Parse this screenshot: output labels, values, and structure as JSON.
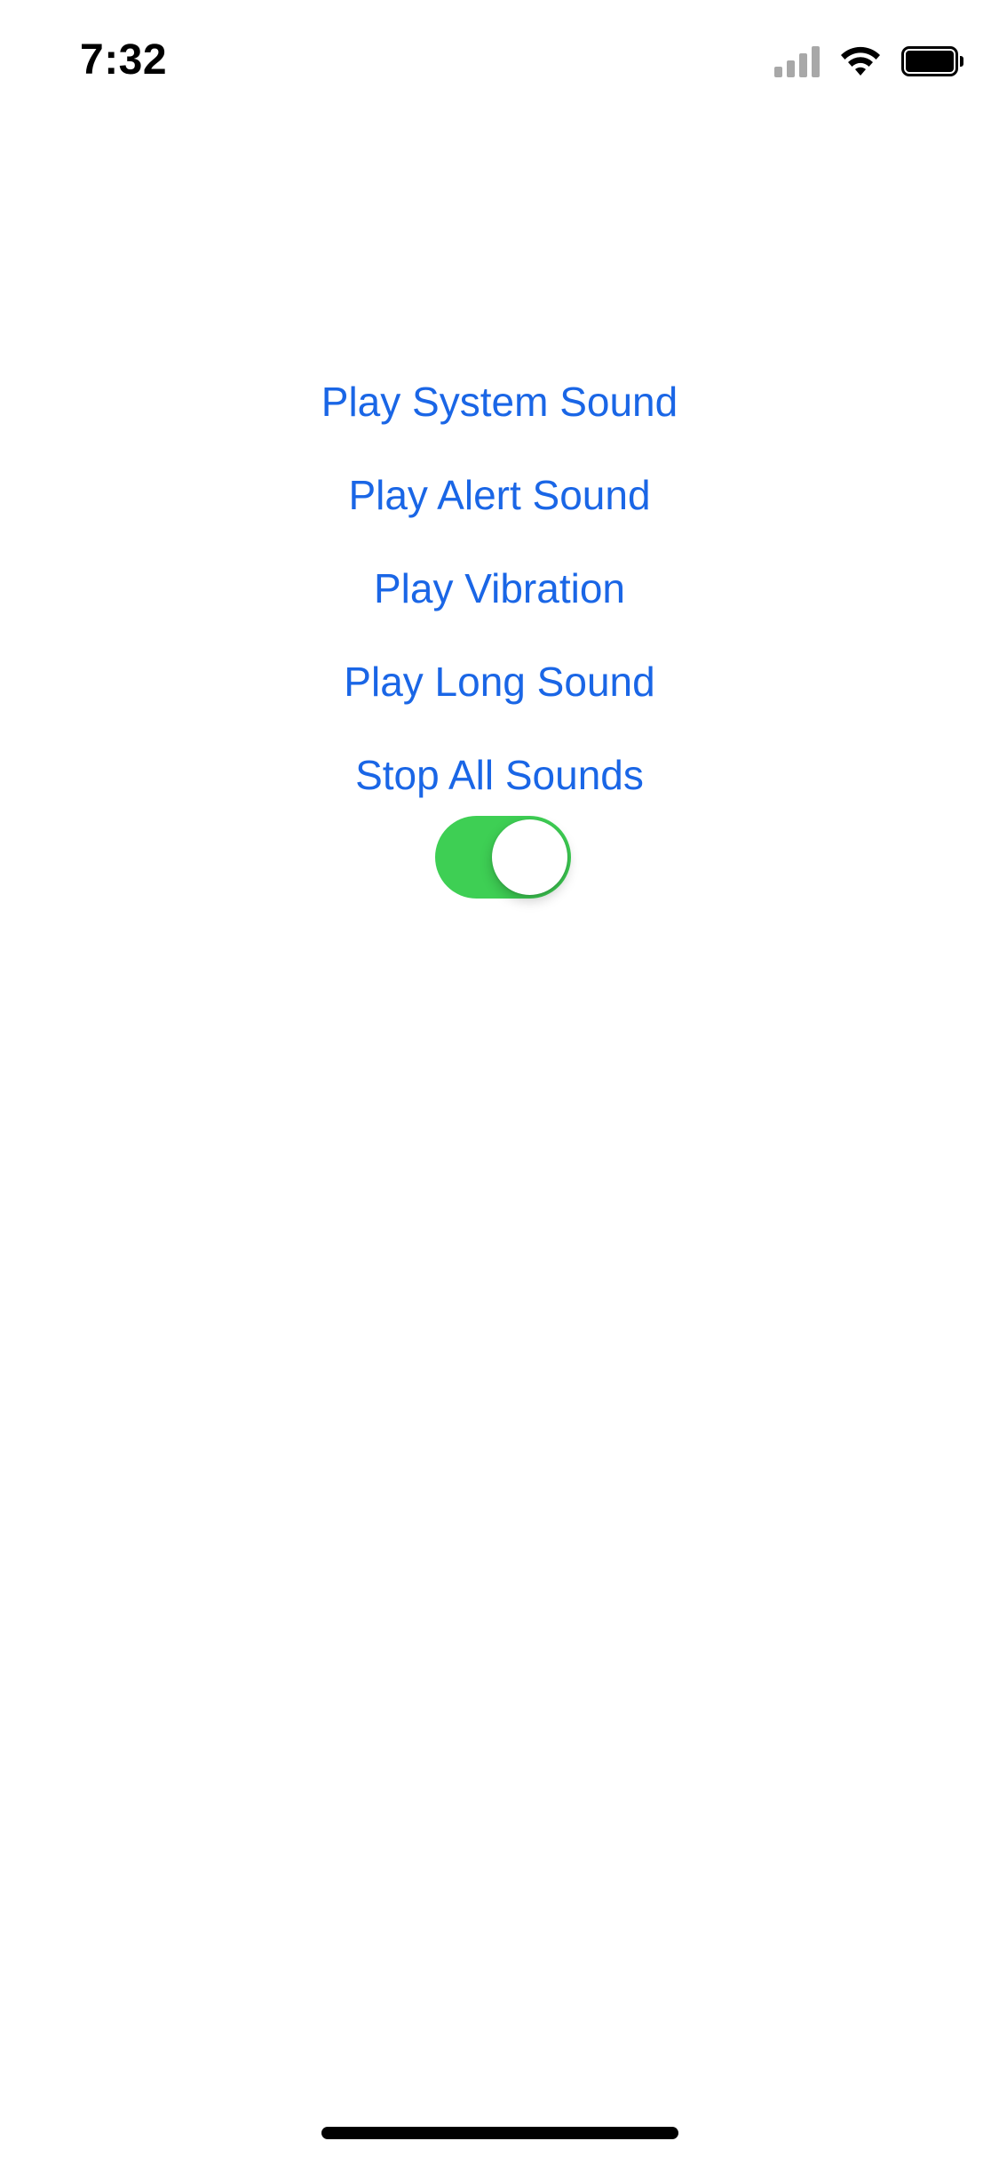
{
  "status_bar": {
    "time": "7:32",
    "icons": [
      "cellular-signal-icon",
      "wifi-icon",
      "battery-icon"
    ]
  },
  "actions": {
    "play_system_sound": "Play System Sound",
    "play_alert_sound": "Play Alert Sound",
    "play_vibration": "Play Vibration",
    "play_long_sound": "Play Long Sound",
    "stop_all_sounds": "Stop All Sounds"
  },
  "toggle": {
    "state": "on"
  },
  "colors": {
    "accent": "#1a66e6",
    "toggle_on": "#3ecf54",
    "background": "#ffffff"
  }
}
